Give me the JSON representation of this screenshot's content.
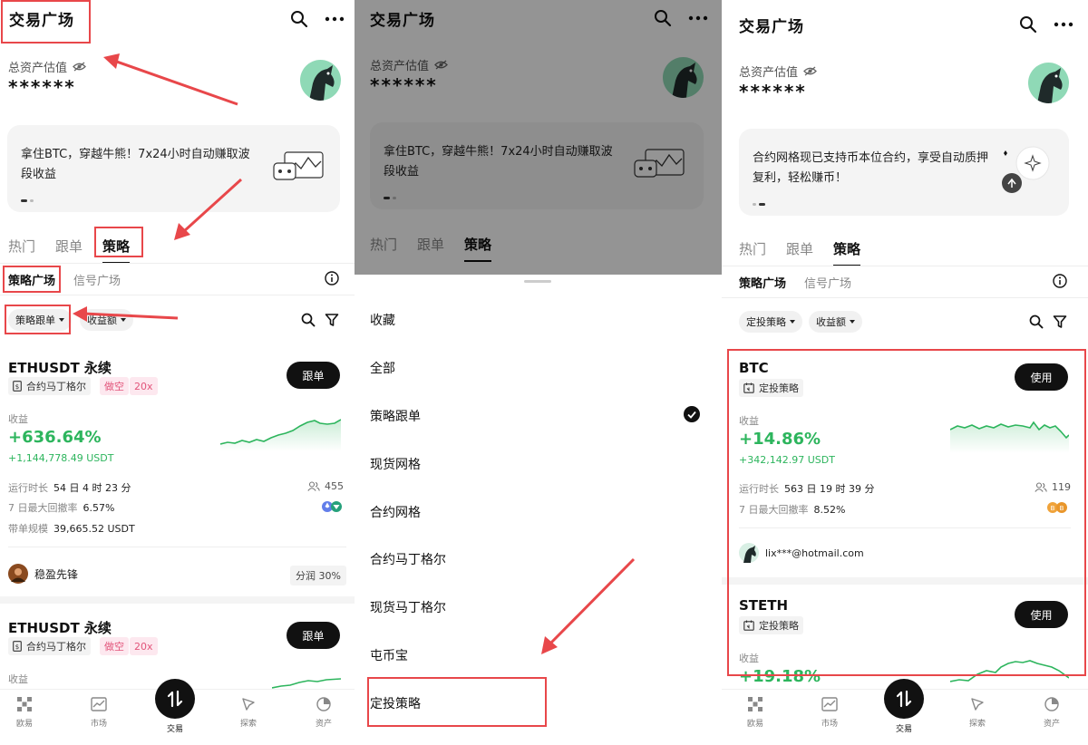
{
  "panel1": {
    "title": "交易广场",
    "est_label": "总资产估值",
    "est_value": "******",
    "banner_text": "拿住BTC，穿越牛熊！7x24小时自动赚取波段收益",
    "tabs": [
      {
        "label": "热门"
      },
      {
        "label": "跟单"
      },
      {
        "label": "策略"
      }
    ],
    "subtabs": [
      {
        "label": "策略广场"
      },
      {
        "label": "信号广场"
      }
    ],
    "filters": [
      {
        "label": "策略跟单"
      },
      {
        "label": "收益额"
      }
    ],
    "card1": {
      "title": "ETHUSDT 永续",
      "tag_type": "合约马丁格尔",
      "tag_side": "做空",
      "tag_lev": "20x",
      "button": "跟单",
      "profit_label": "收益",
      "profit_pct": "+636.64%",
      "profit_amt": "+1,144,778.49 USDT",
      "runtime_label": "运行时长",
      "runtime": "54 日 4 时 23 分",
      "drawdown_label": "7 日最大回撤率",
      "drawdown": "6.57%",
      "scale_label": "带单规模",
      "scale": "39,665.52 USDT",
      "followers": "455",
      "owner": "稳盈先锋",
      "share": "分润 30%"
    },
    "card2": {
      "title": "ETHUSDT 永续",
      "tag_type": "合约马丁格尔",
      "tag_side": "做空",
      "tag_lev": "20x",
      "button": "跟单",
      "profit_label": "收益"
    }
  },
  "panel2": {
    "title": "交易广场",
    "est_label": "总资产估值",
    "est_value": "******",
    "banner_text": "拿住BTC，穿越牛熊！7x24小时自动赚取波段收益",
    "tabs": [
      {
        "label": "热门"
      },
      {
        "label": "跟单"
      },
      {
        "label": "策略"
      }
    ],
    "sheet_items": [
      {
        "label": "收藏"
      },
      {
        "label": "全部"
      },
      {
        "label": "策略跟单"
      },
      {
        "label": "现货网格"
      },
      {
        "label": "合约网格"
      },
      {
        "label": "合约马丁格尔"
      },
      {
        "label": "现货马丁格尔"
      },
      {
        "label": "屯币宝"
      },
      {
        "label": "定投策略"
      }
    ]
  },
  "panel3": {
    "title": "交易广场",
    "est_label": "总资产估值",
    "est_value": "******",
    "banner_text": "合约网格现已支持币本位合约，享受自动质押复利，轻松赚币！",
    "tabs": [
      {
        "label": "热门"
      },
      {
        "label": "跟单"
      },
      {
        "label": "策略"
      }
    ],
    "subtabs": [
      {
        "label": "策略广场"
      },
      {
        "label": "信号广场"
      }
    ],
    "filters": [
      {
        "label": "定投策略"
      },
      {
        "label": "收益额"
      }
    ],
    "card1": {
      "title": "BTC",
      "tag_type": "定投策略",
      "button": "使用",
      "profit_label": "收益",
      "profit_pct": "+14.86%",
      "profit_amt": "+342,142.97 USDT",
      "runtime_label": "运行时长",
      "runtime": "563 日 19 时 39 分",
      "drawdown_label": "7 日最大回撤率",
      "drawdown": "8.52%",
      "followers": "119",
      "owner": "lix***@hotmail.com"
    },
    "card2": {
      "title": "STETH",
      "tag_type": "定投策略",
      "button": "使用",
      "profit_label": "收益",
      "profit_pct": "+19.18%"
    }
  },
  "nav": [
    {
      "label": "欧易"
    },
    {
      "label": "市场"
    },
    {
      "label": "交易"
    },
    {
      "label": "探索"
    },
    {
      "label": "资产"
    }
  ],
  "colors": {
    "accent_green": "#2db55d",
    "highlight_red": "#e8474a"
  }
}
